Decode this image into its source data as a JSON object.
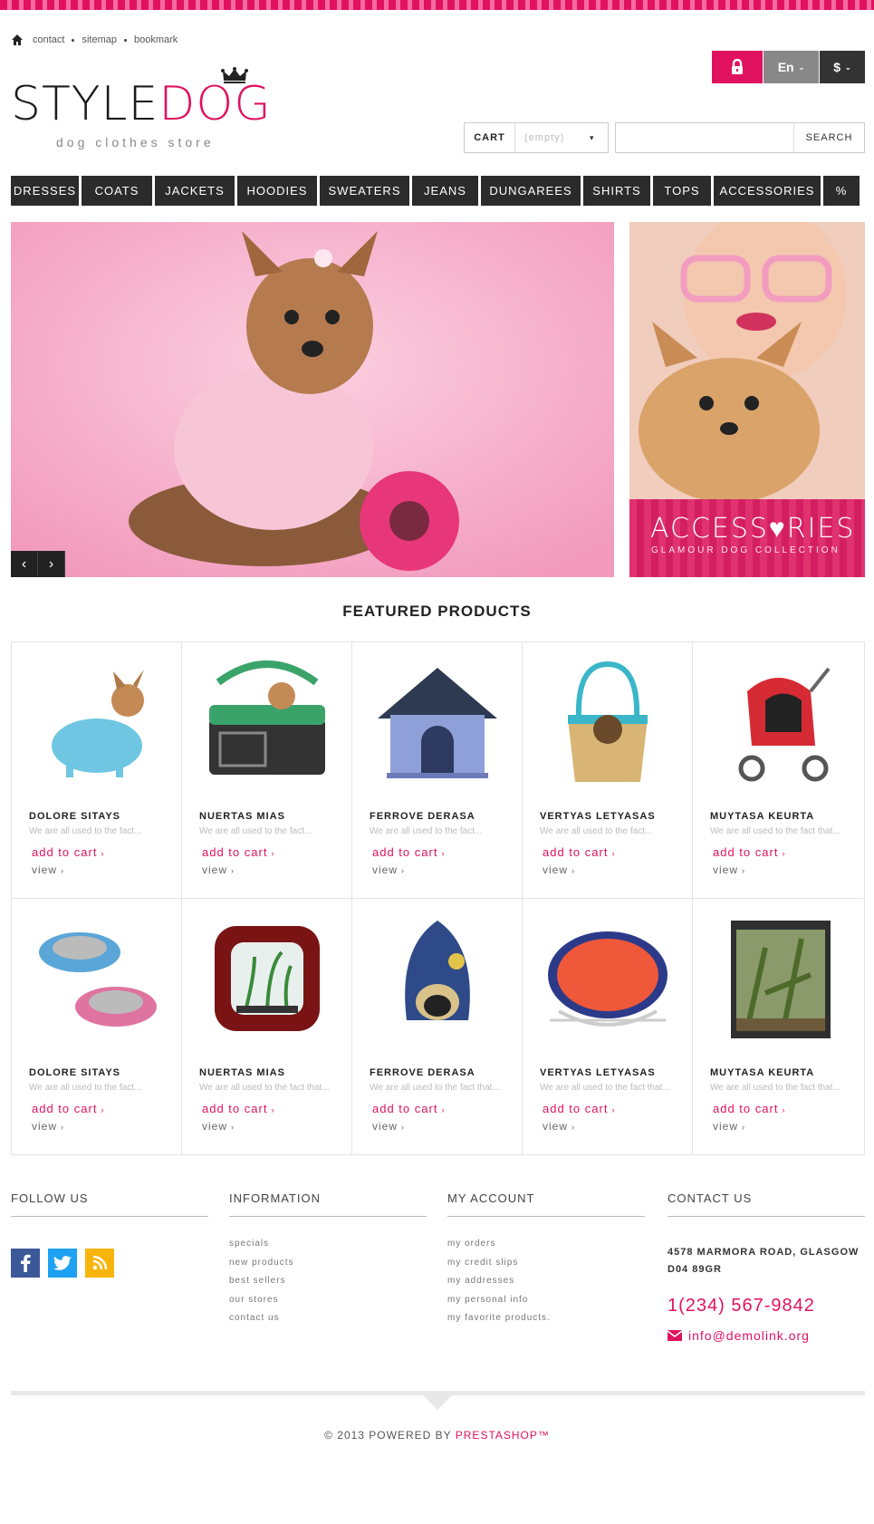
{
  "toplinks": {
    "items": [
      "contact",
      "sitemap",
      "bookmark"
    ]
  },
  "logo": {
    "word_a": "STYLE",
    "word_b": "DOG",
    "tagline": "dog clothes store"
  },
  "header": {
    "lang": "En",
    "currency": "$"
  },
  "cart": {
    "label": "CART",
    "value": "(empty)"
  },
  "search": {
    "placeholder": "",
    "button": "SEARCH"
  },
  "nav": [
    "DRESSES",
    "COATS",
    "JACKETS",
    "HOODIES",
    "SWEATERS",
    "JEANS",
    "DUNGAREES",
    "SHIRTS",
    "TOPS",
    "ACCESSORIES",
    "%"
  ],
  "promo": {
    "title": "ACCESS♥RIES",
    "subtitle": "GLAMOUR DOG COLLECTION"
  },
  "featured": {
    "title": "FEATURED PRODUCTS",
    "add_label": "add to cart",
    "view_label": "view",
    "products": [
      {
        "name": "DOLORE SITAYS",
        "desc": "We are all used to the fact..."
      },
      {
        "name": "NUERTAS MIAS",
        "desc": "We are all used to the fact..."
      },
      {
        "name": "FERROVE DERASA",
        "desc": "We are all used to the fact..."
      },
      {
        "name": "VERTYAS LETYASAS",
        "desc": "We are all used to the fact..."
      },
      {
        "name": "MUYTASA KEURTA",
        "desc": "We are all used to the fact that..."
      },
      {
        "name": "DOLORE SITAYS",
        "desc": "We are all used to the fact..."
      },
      {
        "name": "NUERTAS MIAS",
        "desc": "We are all used to the fact that..."
      },
      {
        "name": "FERROVE DERASA",
        "desc": "We are all used to the fact that..."
      },
      {
        "name": "VERTYAS LETYASAS",
        "desc": "We are all used to the fact that..."
      },
      {
        "name": "MUYTASA KEURTA",
        "desc": "We are all used to the fact that..."
      }
    ]
  },
  "footer": {
    "follow_title": "FOLLOW US",
    "info_title": "INFORMATION",
    "info_items": [
      "specials",
      "new products",
      "best sellers",
      "our stores",
      "contact us"
    ],
    "account_title": "MY ACCOUNT",
    "account_items": [
      "my orders",
      "my credit slips",
      "my addresses",
      "my personal info",
      "my favorite products."
    ],
    "contact_title": "CONTACT US",
    "address_line1": "4578 MARMORA ROAD, GLASGOW",
    "address_line2": "D04 89GR",
    "phone": "1(234) 567-9842",
    "email": "info@demolink.org",
    "copyright": "© 2013 POWERED BY ",
    "brand": "PRESTASHOP™"
  },
  "colors": {
    "accent": "#e0125f",
    "nav_bg": "#2b2b2b",
    "lang_bg": "#888888",
    "currency_bg": "#333333"
  }
}
